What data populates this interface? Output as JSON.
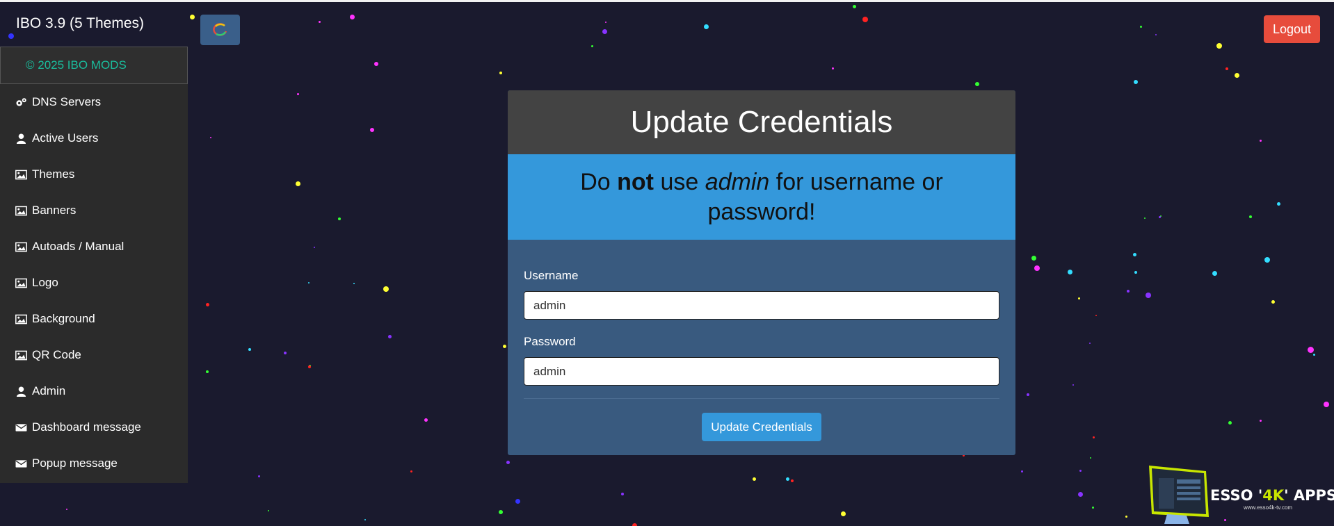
{
  "app": {
    "title": "IBO 3.9 (5 Themes)"
  },
  "header": {
    "logout_label": "Logout",
    "toggle_icon": "refresh-icon"
  },
  "sidebar": {
    "copyright": "© 2025 IBO MODS",
    "items": [
      {
        "label": "DNS Servers",
        "icon": "gears-icon"
      },
      {
        "label": "Active Users",
        "icon": "user-icon"
      },
      {
        "label": "Themes",
        "icon": "image-icon"
      },
      {
        "label": "Banners",
        "icon": "image-icon"
      },
      {
        "label": "Autoads / Manual",
        "icon": "image-icon"
      },
      {
        "label": "Logo",
        "icon": "image-icon"
      },
      {
        "label": "Background",
        "icon": "image-icon"
      },
      {
        "label": "QR Code",
        "icon": "image-icon"
      },
      {
        "label": "Admin",
        "icon": "user-icon"
      },
      {
        "label": "Dashboard message",
        "icon": "envelope-icon"
      },
      {
        "label": "Popup message",
        "icon": "envelope-icon"
      }
    ]
  },
  "card": {
    "title": "Update Credentials",
    "alert": {
      "part1": "Do ",
      "bold": "not",
      "part2": " use ",
      "italic": "admin",
      "part3": " for username or password!"
    },
    "username_label": "Username",
    "username_value": "admin",
    "password_label": "Password",
    "password_value": "admin",
    "submit_label": "Update Credentials"
  },
  "watermark": {
    "title_pre": "ESSO '",
    "title_accent": "4K",
    "title_post": "' APPS",
    "url": "www.esso4k-tv.com"
  },
  "colors": {
    "background": "#1a1a2e",
    "sidebar": "#2b2b2b",
    "copyright": "#1abc9c",
    "logout": "#e74c3c",
    "card_head": "#434343",
    "alert": "#3498db",
    "card_body": "#395a7f",
    "primary_button": "#3498db"
  }
}
